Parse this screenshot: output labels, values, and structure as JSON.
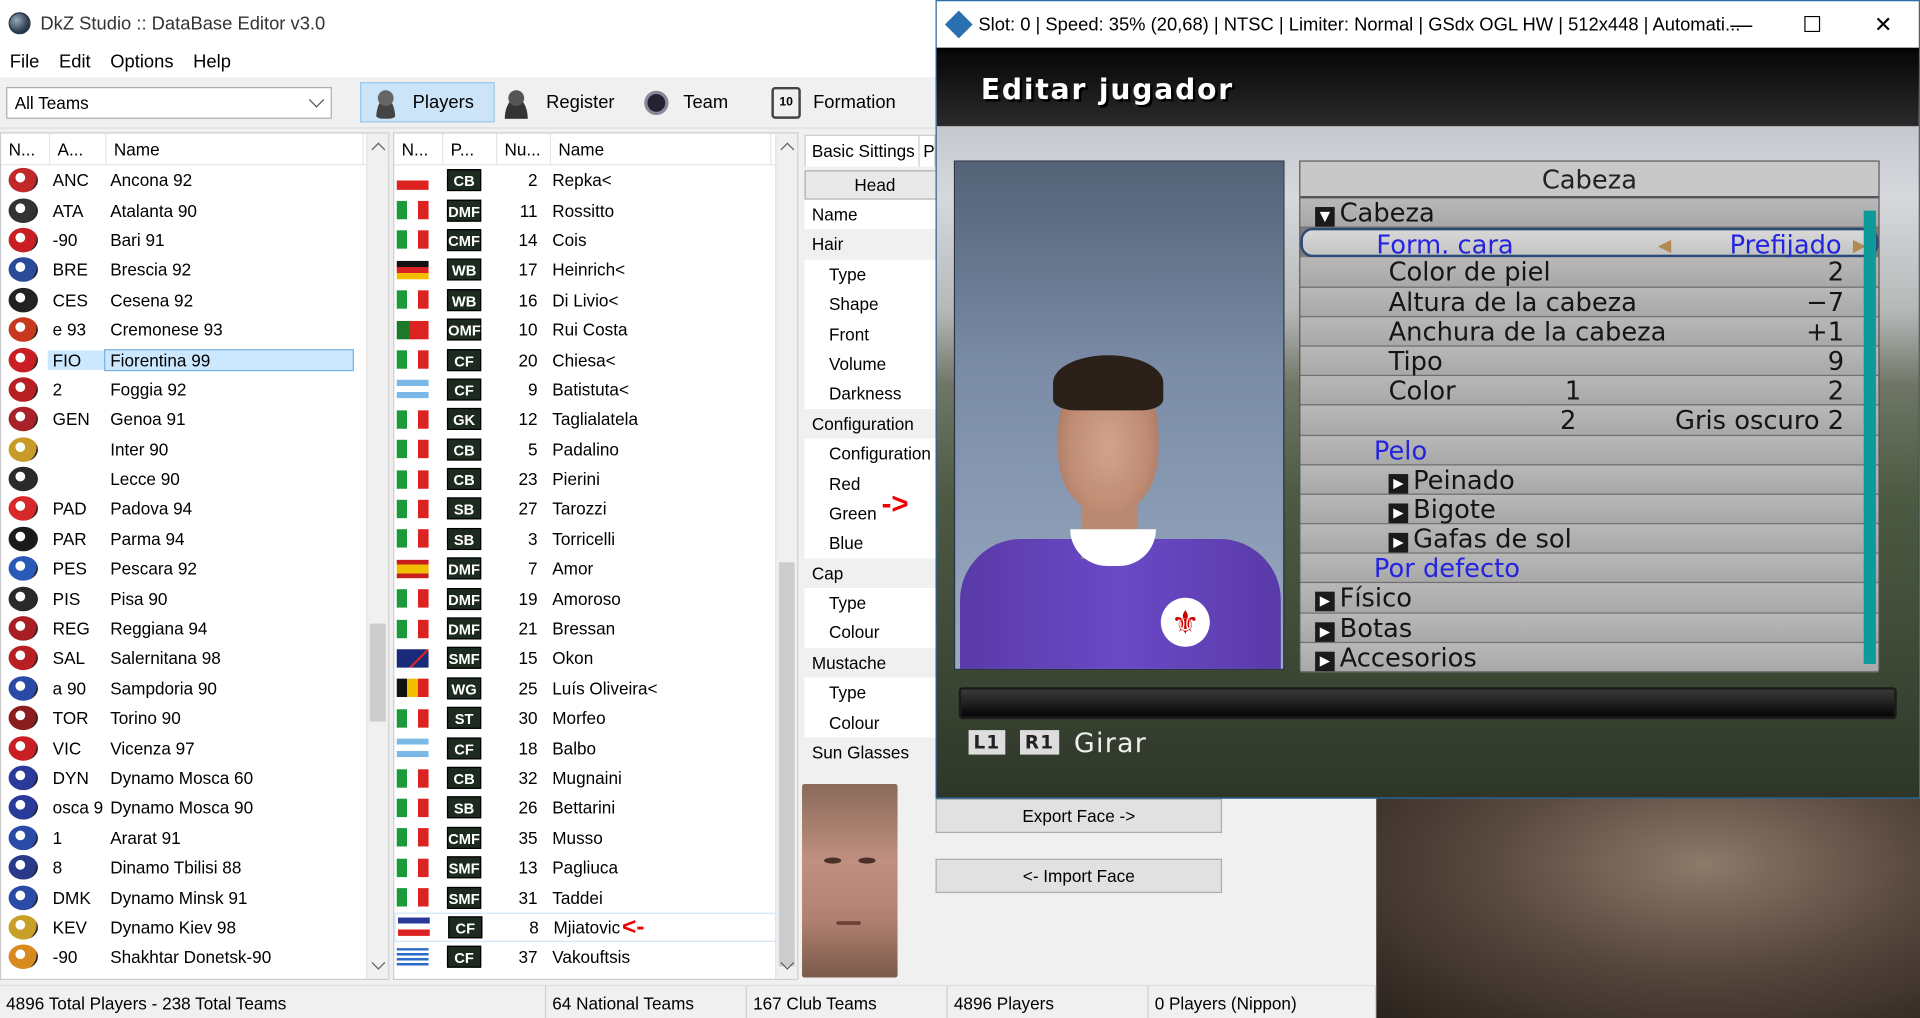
{
  "editor": {
    "title": "DkZ Studio :: DataBase Editor v3.0",
    "menu": [
      "File",
      "Edit",
      "Options",
      "Help"
    ],
    "team_filter": "All Teams",
    "toolbar": [
      "Players",
      "Register",
      "Team",
      "Formation"
    ],
    "teams_headers": [
      "N...",
      "A...",
      "Name"
    ],
    "teams": [
      {
        "abbr": "ANC",
        "name": "Ancona 92",
        "color": "#c0282a"
      },
      {
        "abbr": "ATA",
        "name": "Atalanta 90",
        "color": "#333333"
      },
      {
        "abbr": "-90",
        "name": "Bari 91",
        "color": "#c81e24"
      },
      {
        "abbr": "BRE",
        "name": "Brescia 92",
        "color": "#2a4a9a"
      },
      {
        "abbr": "CES",
        "name": "Cesena 92",
        "color": "#222222"
      },
      {
        "abbr": "e 93",
        "name": "Cremonese 93",
        "color": "#c8381e"
      },
      {
        "abbr": "FIO",
        "name": "Fiorentina 99",
        "color": "#c81e24"
      },
      {
        "abbr": "2",
        "name": "Foggia 92",
        "color": "#b81e22"
      },
      {
        "abbr": "GEN",
        "name": "Genoa 91",
        "color": "#a82028"
      },
      {
        "abbr": "",
        "name": "Inter 90",
        "color": "#c89a28"
      },
      {
        "abbr": "",
        "name": "Lecce 90",
        "color": "#2a2a2a"
      },
      {
        "abbr": "PAD",
        "name": "Padova 94",
        "color": "#d8282a"
      },
      {
        "abbr": "PAR",
        "name": "Parma 94",
        "color": "#1a1a1a"
      },
      {
        "abbr": "PES",
        "name": "Pescara 92",
        "color": "#2a5ab8"
      },
      {
        "abbr": "PIS",
        "name": "Pisa 90",
        "color": "#2a2a2a"
      },
      {
        "abbr": "REG",
        "name": "Reggiana 94",
        "color": "#a81e24"
      },
      {
        "abbr": "SAL",
        "name": "Salernitana 98",
        "color": "#b81e24"
      },
      {
        "abbr": "a 90",
        "name": "Sampdoria 90",
        "color": "#2a4aa8"
      },
      {
        "abbr": "TOR",
        "name": "Torino 90",
        "color": "#8a1e1e"
      },
      {
        "abbr": "VIC",
        "name": "Vicenza 97",
        "color": "#c81e24"
      },
      {
        "abbr": "DYN",
        "name": "Dynamo Mosca 60",
        "color": "#2a3a9a"
      },
      {
        "abbr": "osca 9",
        "name": "Dynamo Mosca 90",
        "color": "#2a3a9a"
      },
      {
        "abbr": "1",
        "name": "Ararat 91",
        "color": "#2a4aa8"
      },
      {
        "abbr": "8",
        "name": "Dinamo Tbilisi 88",
        "color": "#2a3a8a"
      },
      {
        "abbr": "DMK",
        "name": "Dynamo Minsk 91",
        "color": "#2a4aa8"
      },
      {
        "abbr": "KEV",
        "name": "Dynamo Kiev 98",
        "color": "#c8a028"
      },
      {
        "abbr": "-90",
        "name": "Shakhtar Donetsk-90",
        "color": "#d88a1e"
      }
    ],
    "players_headers": [
      "N...",
      "P...",
      "Nu...",
      "Name"
    ],
    "players": [
      {
        "flag": "cz",
        "pos": "CB",
        "num": "2",
        "name": "Repka<"
      },
      {
        "flag": "it",
        "pos": "DMF",
        "num": "11",
        "name": "Rossitto"
      },
      {
        "flag": "it",
        "pos": "CMF",
        "num": "14",
        "name": "Cois"
      },
      {
        "flag": "de",
        "pos": "WB",
        "num": "17",
        "name": "Heinrich<"
      },
      {
        "flag": "it",
        "pos": "WB",
        "num": "16",
        "name": "Di Livio<"
      },
      {
        "flag": "pt",
        "pos": "OMF",
        "num": "10",
        "name": "Rui Costa"
      },
      {
        "flag": "it",
        "pos": "CF",
        "num": "20",
        "name": "Chiesa<"
      },
      {
        "flag": "ar",
        "pos": "CF",
        "num": "9",
        "name": "Batistuta<"
      },
      {
        "flag": "it",
        "pos": "GK",
        "num": "12",
        "name": "Taglialatela"
      },
      {
        "flag": "it",
        "pos": "CB",
        "num": "5",
        "name": "Padalino"
      },
      {
        "flag": "it",
        "pos": "CB",
        "num": "23",
        "name": "Pierini"
      },
      {
        "flag": "it",
        "pos": "SB",
        "num": "27",
        "name": "Tarozzi"
      },
      {
        "flag": "it",
        "pos": "SB",
        "num": "3",
        "name": "Torricelli"
      },
      {
        "flag": "es",
        "pos": "DMF",
        "num": "7",
        "name": "Amor"
      },
      {
        "flag": "it",
        "pos": "DMF",
        "num": "19",
        "name": "Amoroso"
      },
      {
        "flag": "it",
        "pos": "DMF",
        "num": "21",
        "name": "Bressan"
      },
      {
        "flag": "au",
        "pos": "SMF",
        "num": "15",
        "name": "Okon"
      },
      {
        "flag": "be",
        "pos": "WG",
        "num": "25",
        "name": "Luís Oliveira<"
      },
      {
        "flag": "it",
        "pos": "ST",
        "num": "30",
        "name": "Morfeo"
      },
      {
        "flag": "ar",
        "pos": "CF",
        "num": "18",
        "name": "Balbo"
      },
      {
        "flag": "it",
        "pos": "CB",
        "num": "32",
        "name": "Mugnaini"
      },
      {
        "flag": "it",
        "pos": "SB",
        "num": "26",
        "name": "Bettarini"
      },
      {
        "flag": "it",
        "pos": "CMF",
        "num": "35",
        "name": "Musso"
      },
      {
        "flag": "it",
        "pos": "SMF",
        "num": "13",
        "name": "Pagliuca"
      },
      {
        "flag": "it",
        "pos": "SMF",
        "num": "31",
        "name": "Taddei"
      },
      {
        "flag": "yu",
        "pos": "CF",
        "num": "8",
        "name": "Mjiatovic"
      },
      {
        "flag": "gr",
        "pos": "CF",
        "num": "37",
        "name": "Vakouftsis"
      }
    ],
    "tabs": [
      "Basic Sittings",
      "P"
    ],
    "head_button": "Head",
    "properties": [
      {
        "kind": "sub",
        "label": "Name"
      },
      {
        "kind": "cat",
        "label": "Hair"
      },
      {
        "kind": "sub",
        "label": "Type"
      },
      {
        "kind": "sub",
        "label": "Shape"
      },
      {
        "kind": "sub",
        "label": "Front"
      },
      {
        "kind": "sub",
        "label": "Volume"
      },
      {
        "kind": "sub",
        "label": "Darkness"
      },
      {
        "kind": "cat",
        "label": "Configuration"
      },
      {
        "kind": "sub",
        "label": "Configuration"
      },
      {
        "kind": "sub",
        "label": "Red"
      },
      {
        "kind": "sub",
        "label": "Green"
      },
      {
        "kind": "sub",
        "label": "Blue"
      },
      {
        "kind": "cat",
        "label": "Cap"
      },
      {
        "kind": "sub",
        "label": "Type"
      },
      {
        "kind": "sub",
        "label": "Colour"
      },
      {
        "kind": "cat",
        "label": "Mustache"
      },
      {
        "kind": "sub",
        "label": "Type"
      },
      {
        "kind": "sub",
        "label": "Colour"
      },
      {
        "kind": "cat",
        "label": "Sun Glasses"
      }
    ],
    "arrow_right": "->",
    "arrow_left": "<-",
    "export_face": "Export Face ->",
    "import_face": "<- Import Face",
    "status": [
      "4896 Total Players  -  238 Total Teams",
      "64 National Teams",
      "167 Club Teams",
      "4896 Players",
      "0 Players (Nippon)"
    ]
  },
  "emulator": {
    "title": "Slot: 0 | Speed:  35% (20,68) | NTSC | Limiter: Normal | GSdx OGL HW | 512x448 | Automati...",
    "controls": [
      "—",
      "☐",
      "✕"
    ],
    "screen_title": "Editar jugador",
    "panel_title": "Cabeza",
    "items": [
      {
        "label": "Cabeza",
        "style": "tri-down",
        "value": ""
      },
      {
        "label": "Form. cara",
        "style": "selected",
        "value": "Prefijado"
      },
      {
        "label": "Color de piel",
        "style": "indent",
        "value": "2"
      },
      {
        "label": "Altura de la cabeza",
        "style": "indent",
        "value": "−7"
      },
      {
        "label": "Anchura de la cabeza",
        "style": "indent",
        "value": "+1"
      },
      {
        "label": "Tipo",
        "style": "indent",
        "value": "9"
      },
      {
        "label": "Color",
        "style": "indent",
        "mid": "1",
        "value": "2"
      },
      {
        "label": "",
        "style": "indent",
        "mid": "2",
        "value": "Gris oscuro 2"
      },
      {
        "label": "Pelo",
        "style": "blue",
        "value": ""
      },
      {
        "label": "Peinado",
        "style": "tri-sub",
        "value": ""
      },
      {
        "label": "Bigote",
        "style": "tri-sub",
        "value": ""
      },
      {
        "label": "Gafas de sol",
        "style": "tri-sub",
        "value": ""
      },
      {
        "label": "Por defecto",
        "style": "blue",
        "value": ""
      },
      {
        "label": "Físico",
        "style": "tri",
        "value": ""
      },
      {
        "label": "Botas",
        "style": "tri",
        "value": ""
      },
      {
        "label": "Accesorios",
        "style": "tri",
        "value": ""
      }
    ],
    "hint_keys": [
      "L1",
      "R1"
    ],
    "hint_text": "Girar"
  }
}
